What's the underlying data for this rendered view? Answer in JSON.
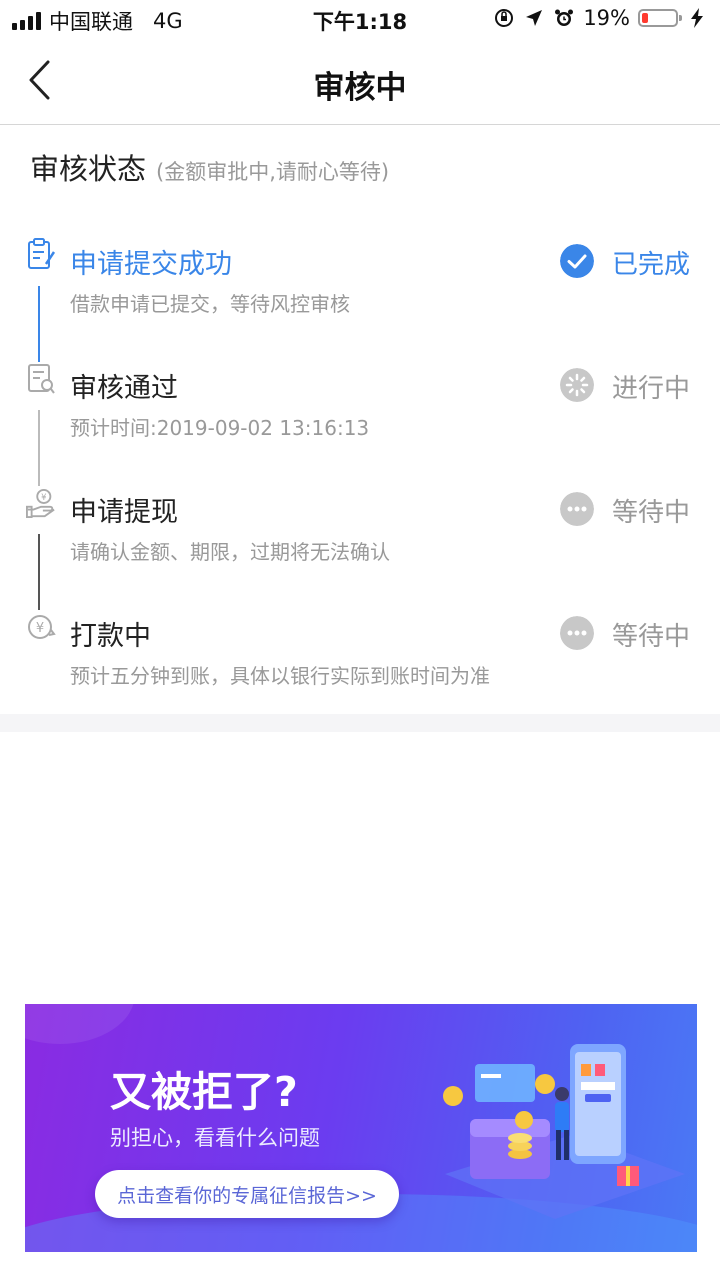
{
  "status_bar": {
    "carrier": "中国联通",
    "network": "4G",
    "time": "下午1:18",
    "battery": "19%",
    "battery_level": 0.19,
    "battery_color": "#ff3b30"
  },
  "nav": {
    "title": "审核中",
    "back_icon": "chevron-left-icon"
  },
  "review": {
    "title": "审核状态",
    "subtitle": "(金额审批中,请耐心等待)",
    "steps": [
      {
        "title": "申请提交成功",
        "desc": "借款申请已提交，等待风控审核",
        "status": "已完成",
        "state": "done",
        "icon": "clipboard-icon"
      },
      {
        "title": "审核通过",
        "desc": "预计时间:2019-09-02 13:16:13",
        "status": "进行中",
        "state": "in-progress",
        "icon": "document-search-icon"
      },
      {
        "title": "申请提现",
        "desc": "请确认金额、期限，过期将无法确认",
        "status": "等待中",
        "state": "waiting",
        "icon": "hand-coin-icon"
      },
      {
        "title": "打款中",
        "desc": "预计五分钟到账，具体以银行实际到账时间为准",
        "status": "等待中",
        "state": "waiting",
        "icon": "yuan-transfer-icon"
      }
    ]
  },
  "banner": {
    "title": "又被拒了?",
    "subtitle": "别担心，看看什么问题",
    "button": "点击查看你的专属征信报告>>"
  },
  "colors": {
    "accent": "#3a86e8",
    "muted": "#999999",
    "status_done_bg": "#3a86e8",
    "status_wait_bg": "#c8c8c8"
  }
}
